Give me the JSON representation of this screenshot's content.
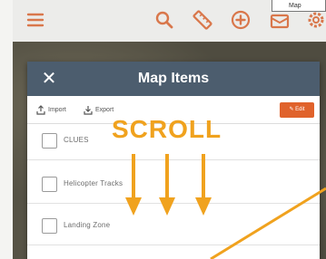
{
  "app_bar": {
    "icons": [
      "menu-icon",
      "search-icon",
      "ruler-icon",
      "add-circle-icon",
      "layers-icon",
      "gear-icon"
    ],
    "chip_text": "Map",
    "accent": "#d9774b"
  },
  "modal": {
    "title": "Map Items",
    "close_icon": "close-icon",
    "header_color": "#4c5d6e",
    "toolbar": {
      "import_label": "Import",
      "export_label": "Export",
      "edit_label": "Edit",
      "edit_color": "#e0622b"
    },
    "items": [
      {
        "label": "CLUES"
      },
      {
        "label": "Helicopter Tracks"
      },
      {
        "label": "Landing Zone"
      }
    ]
  },
  "annotation": {
    "text": "SCROLL",
    "color": "#f0a21e"
  }
}
